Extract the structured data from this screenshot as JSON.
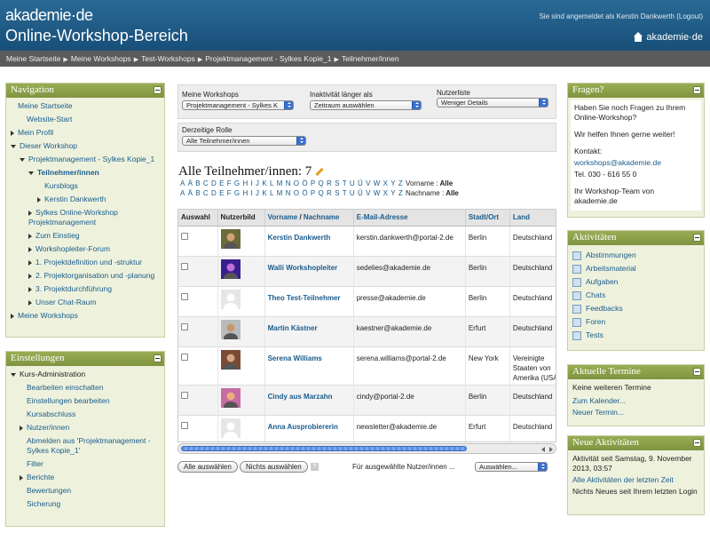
{
  "header": {
    "logo": "akademie·de",
    "site_title": "Online-Workshop-Bereich",
    "login_text": "Sie sind angemeldet als Kerstin Dankwerth (Logout)",
    "brand_right": "akademie·de"
  },
  "breadcrumb": [
    "Meine Startseite",
    "Meine Workshops",
    "Test-Workshops",
    "Projektmanagement - Sylkes Kopie_1",
    "Teilnehmer/innen"
  ],
  "navigation": {
    "title": "Navigation",
    "items": [
      {
        "label": "Meine Startseite",
        "level": 0,
        "icon": "none"
      },
      {
        "label": "Website-Start",
        "level": 1,
        "icon": "none"
      },
      {
        "label": "Mein Profil",
        "level": 0,
        "icon": "collapsed"
      },
      {
        "label": "Dieser Workshop",
        "level": 0,
        "icon": "expanded"
      },
      {
        "label": "Projektmanagement - Sylkes Kopie_1",
        "level": 1,
        "icon": "expanded"
      },
      {
        "label": "Teilnehmer/innen",
        "level": 2,
        "icon": "expanded",
        "current": true
      },
      {
        "label": "Kursblogs",
        "level": 3,
        "icon": "none"
      },
      {
        "label": "Kerstin Dankwerth",
        "level": 3,
        "icon": "collapsed"
      },
      {
        "label": "Sylkes Online-Workshop Projektmanagement",
        "level": 2,
        "icon": "collapsed"
      },
      {
        "label": "Zum Einstieg",
        "level": 2,
        "icon": "collapsed"
      },
      {
        "label": "Workshopleiter-Forum",
        "level": 2,
        "icon": "collapsed"
      },
      {
        "label": "1. Projektdefinition und -struktur",
        "level": 2,
        "icon": "collapsed"
      },
      {
        "label": "2. Projektorganisation und -planung",
        "level": 2,
        "icon": "collapsed"
      },
      {
        "label": "3. Projektdurchführung",
        "level": 2,
        "icon": "collapsed"
      },
      {
        "label": "Unser Chat-Raum",
        "level": 2,
        "icon": "collapsed"
      },
      {
        "label": "Meine Workshops",
        "level": 0,
        "icon": "collapsed"
      }
    ]
  },
  "settings": {
    "title": "Einstellungen",
    "items": [
      {
        "label": "Kurs-Administration",
        "level": 0,
        "icon": "expanded",
        "link": false
      },
      {
        "label": "Bearbeiten einschalten",
        "level": 1,
        "icon": "none",
        "link": true
      },
      {
        "label": "Einstellungen bearbeiten",
        "level": 1,
        "icon": "none",
        "link": true
      },
      {
        "label": "Kursabschluss",
        "level": 1,
        "icon": "none",
        "link": true
      },
      {
        "label": "Nutzer/innen",
        "level": 1,
        "icon": "collapsed",
        "link": true
      },
      {
        "label": "Abmelden aus 'Projektmanagement - Sylkes Kopie_1'",
        "level": 1,
        "icon": "none",
        "link": true
      },
      {
        "label": "Filter",
        "level": 1,
        "icon": "none",
        "link": true
      },
      {
        "label": "Berichte",
        "level": 1,
        "icon": "collapsed",
        "link": true
      },
      {
        "label": "Bewertungen",
        "level": 1,
        "icon": "none",
        "link": true
      },
      {
        "label": "Sicherung",
        "level": 1,
        "icon": "none",
        "link": true
      }
    ]
  },
  "filters": {
    "my_workshops_label": "Meine Workshops",
    "my_workshops_value": "Projektmanagement - Sylkes K",
    "inactivity_label": "Inaktivität länger als",
    "inactivity_value": "Zeitraum auswählen",
    "userlist_label": "Nutzerliste",
    "userlist_value": "Weniger Details",
    "role_label": "Derzeitige Rolle",
    "role_value": "Alle Teilnehmer/innen"
  },
  "main": {
    "title": "Alle Teilnehmer/innen: 7",
    "letters": [
      "A",
      "Ä",
      "B",
      "C",
      "D",
      "E",
      "F",
      "G",
      "H",
      "I",
      "J",
      "K",
      "L",
      "M",
      "N",
      "O",
      "Ö",
      "P",
      "Q",
      "R",
      "S",
      "T",
      "U",
      "Ü",
      "V",
      "W",
      "X",
      "Y",
      "Z"
    ],
    "firstname_label": "Vorname :",
    "lastname_label": "Nachname :",
    "all_label": "Alle"
  },
  "table": {
    "headers": {
      "select": "Auswahl",
      "picture": "Nutzerbild",
      "firstname": "Vorname",
      "slash": " / ",
      "lastname": "Nachname",
      "email": "E-Mail-Adresse",
      "city": "Stadt/Ort",
      "country": "Land"
    },
    "rows": [
      {
        "name": "Kerstin Dankwerth",
        "email": "kerstin.dankwerth@portal-2.de",
        "city": "Berlin",
        "country": "Deutschland",
        "avatar": "photo-woman"
      },
      {
        "name": "Walli Workshopleiter",
        "email": "sedelies@akademie.de",
        "city": "Berlin",
        "country": "Deutschland",
        "avatar": "photo-purple"
      },
      {
        "name": "Theo Test-Teilnehmer",
        "email": "presse@akademie.de",
        "city": "Berlin",
        "country": "Deutschland",
        "avatar": "default"
      },
      {
        "name": "Martin Kästner",
        "email": "kaestner@akademie.de",
        "city": "Erfurt",
        "country": "Deutschland",
        "avatar": "photo-man"
      },
      {
        "name": "Serena Williams",
        "email": "serena.williams@portal-2.de",
        "city": "New York",
        "country": "Vereinigte Staaten von Amerika (USA)",
        "avatar": "photo-woman2"
      },
      {
        "name": "Cindy aus Marzahn",
        "email": "cindy@portal-2.de",
        "city": "Berlin",
        "country": "Deutschland",
        "avatar": "photo-pink"
      },
      {
        "name": "Anna Ausprobiererin",
        "email": "newsletter@akademie.de",
        "city": "Erfurt",
        "country": "Deutschland",
        "avatar": "default"
      }
    ]
  },
  "actions": {
    "select_all": "Alle auswählen",
    "select_none": "Nichts auswählen",
    "help": "?",
    "for_selected": "Für ausgewählte Nutzer/innen ...",
    "choose": "Auswählen..."
  },
  "questions": {
    "title": "Fragen?",
    "text1": "Haben Sie noch Fragen zu Ihrem Online-Workshop?",
    "text2": "Wir helfen Ihnen gerne weiter!",
    "contact_label": "Kontakt:",
    "email": "workshops@akademie.de",
    "phone": "Tel. 030 - 616 55 0",
    "signoff": "Ihr Workshop-Team von akademie.de"
  },
  "activities": {
    "title": "Aktivitäten",
    "items": [
      "Abstimmungen",
      "Arbeitsmaterial",
      "Aufgaben",
      "Chats",
      "Feedbacks",
      "Foren",
      "Tests"
    ]
  },
  "events": {
    "title": "Aktuelle Termine",
    "none": "Keine weiteren Termine",
    "calendar": "Zum Kalender...",
    "new": "Neuer Termin..."
  },
  "recent": {
    "title": "Neue Aktivitäten",
    "since": "Aktivität seit Samstag, 9. November 2013, 03:57",
    "all_link": "Alle Aktivitäten der letzten Zeit",
    "nothing": "Nichts Neues seit Ihrem letzten Login"
  }
}
